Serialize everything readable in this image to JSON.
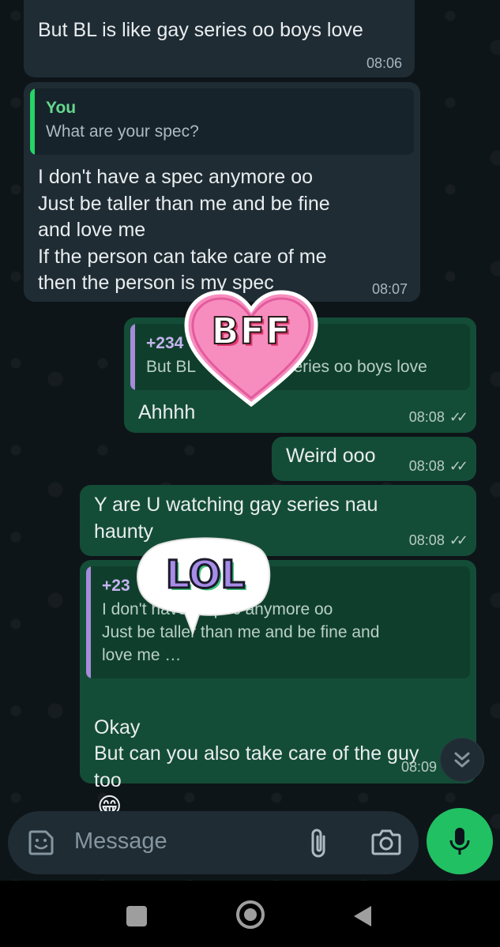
{
  "messages": [
    {
      "text": "But BL is like gay series oo boys love",
      "time": "08:06"
    },
    {
      "quote_author": "You",
      "quote_text": "What are your spec?",
      "text": "I don't have a spec anymore oo\nJust be taller than me and be fine\nand love me\nIf the person can take care of me\nthen the person is my spec",
      "time": "08:07"
    },
    {
      "quote_author": "+234",
      "quote_text_left": "But BL",
      "quote_text_right": "series oo boys love",
      "text": "Ahhhh",
      "time": "08:08"
    },
    {
      "text": "Weird ooo",
      "time": "08:08"
    },
    {
      "text": "Y are U watching gay series nau\nhaunty",
      "time": "08:08"
    },
    {
      "quote_author": "+23",
      "quote_text": "I don't have a spec anymore oo\nJust be taller than me and be fine and\nlove me …",
      "text": "Okay\nBut can you also take care of the guy\ntoo",
      "emoji": "😁",
      "time": "08:09"
    }
  ],
  "stickers": {
    "bff": "BFF",
    "lol": "LOL"
  },
  "composer": {
    "placeholder": "Message"
  },
  "icons": {
    "emoji": "sticker-emoji-icon",
    "attach": "paperclip-icon",
    "camera": "camera-icon",
    "mic": "microphone-icon",
    "scroll": "double-chevron-down-icon",
    "nav": [
      "square-recents-icon",
      "circle-home-icon",
      "triangle-back-icon"
    ]
  },
  "colors": {
    "incoming_bubble": "#1f2c34",
    "outgoing_bubble": "#144d37",
    "quote_you": "#25d366",
    "quote_contact": "#a78bdb",
    "mic_button": "#21c063"
  }
}
